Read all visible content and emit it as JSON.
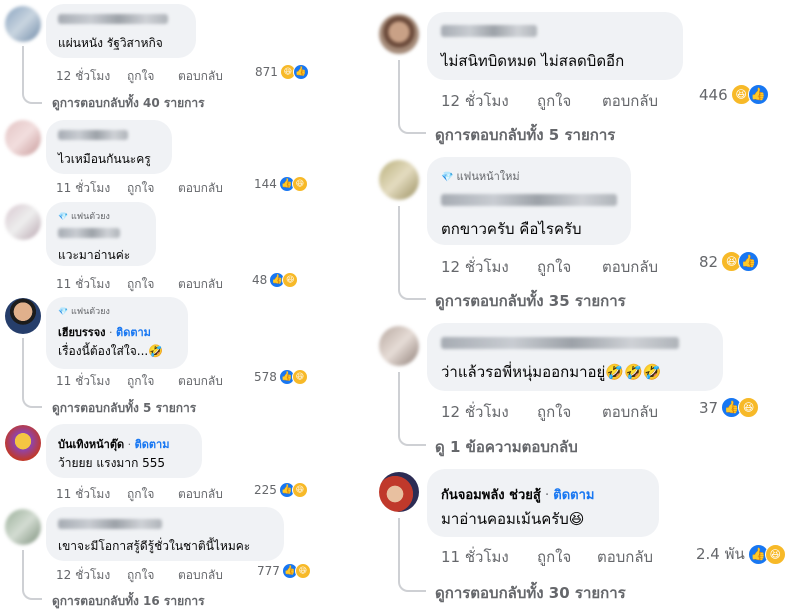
{
  "actions": {
    "like": "ถูกใจ",
    "reply": "ตอบกลับ"
  },
  "fan_badge_label": "แฟนตัวยง",
  "new_fan_label": "แฟนหน้าใหม่",
  "follow_label": "ติดตาม",
  "icons": {
    "like": "like-reaction-icon",
    "haha": "haha-reaction-icon",
    "badge": "diamond-badge-icon"
  },
  "colors": {
    "link": "#1877f2",
    "bubble": "#f0f2f5",
    "meta": "#65676b",
    "like": "#1877f2",
    "haha": "#f7b928"
  },
  "left": [
    {
      "text": "แผ่นหนัง รัฐวิสาหกิจ",
      "time": "12 ชั่วโมง",
      "count": "871",
      "replies": "ดูการตอบกลับทั้ง 40 รายการ"
    },
    {
      "text": "ไวเหมือนกันนะครู",
      "time": "11 ชั่วโมง",
      "count": "144",
      "replies": ""
    },
    {
      "text": "แวะมาอ่านค่ะ",
      "time": "11 ชั่วโมง",
      "count": "48",
      "replies": ""
    },
    {
      "name": "เฮียบรรจง",
      "text": "เรื่องนี้ต้องใส่ใจ...🤣",
      "time": "11 ชั่วโมง",
      "count": "578",
      "replies": "ดูการตอบกลับทั้ง 5 รายการ"
    },
    {
      "name": "บันเทิงหน้าตุ๊ด",
      "text": "ว้ายยย แรงมาก 555",
      "time": "11 ชั่วโมง",
      "count": "225",
      "replies": ""
    },
    {
      "text": "เขาจะมีโอกาสรู้ดีรู้ชั่วในชาตินี้ไหมคะ",
      "time": "12 ชั่วโมง",
      "count": "777",
      "replies": "ดูการตอบกลับทั้ง 16 รายการ"
    }
  ],
  "right": [
    {
      "text": "ไม่สนิทบิดหมด ไม่สลดบิดอีก",
      "time": "12 ชั่วโมง",
      "count": "446",
      "replies": "ดูการตอบกลับทั้ง 5 รายการ"
    },
    {
      "text": "ตกขาวครับ คือไรครับ",
      "time": "12 ชั่วโมง",
      "count": "82",
      "replies": "ดูการตอบกลับทั้ง 35 รายการ"
    },
    {
      "text": "ว่าแล้วรอพี่หนุ่มออกมาอยู่🤣🤣🤣",
      "time": "12 ชั่วโมง",
      "count": "37",
      "replies": "ดู 1 ข้อความตอบกลับ"
    },
    {
      "name": "กันจอมพลัง ช่วยสู้",
      "text": "มาอ่านคอมเม้นครับ😆",
      "time": "11 ชั่วโมง",
      "count": "2.4 พัน",
      "replies": "ดูการตอบกลับทั้ง 30 รายการ"
    }
  ]
}
